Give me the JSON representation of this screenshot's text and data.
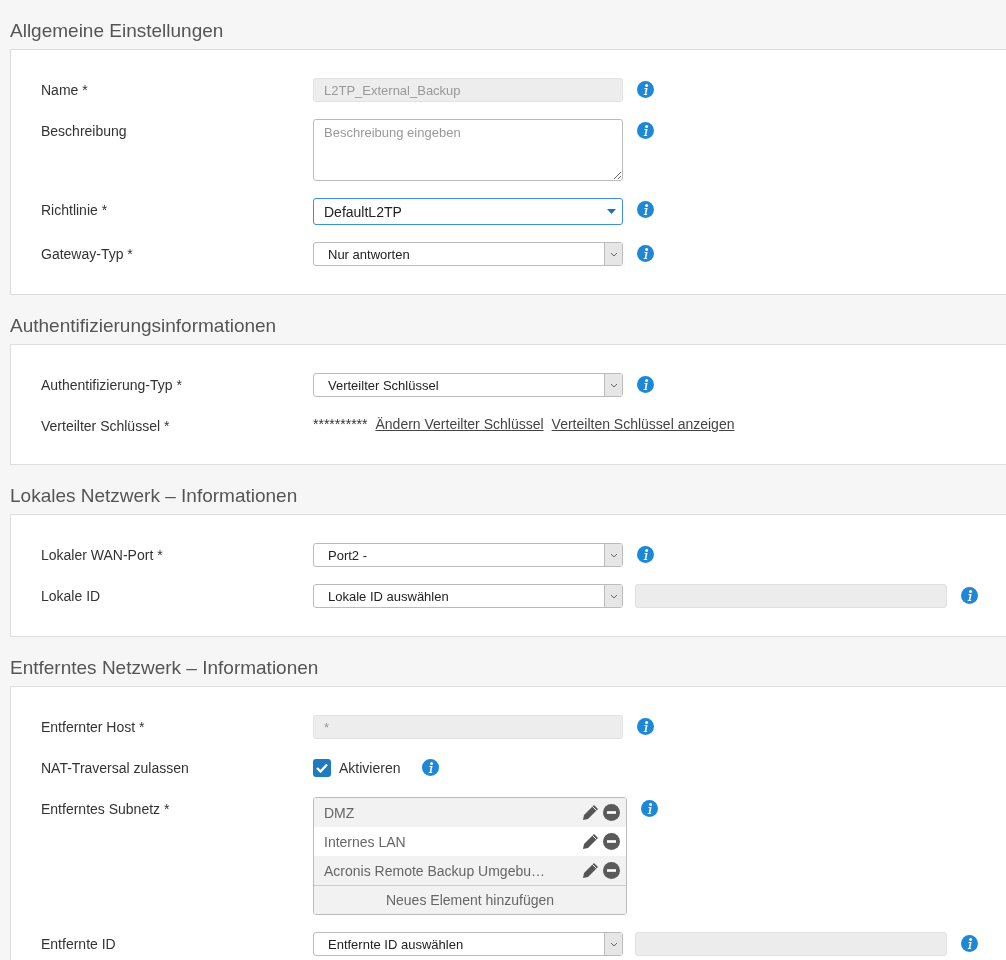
{
  "sections": [
    {
      "title": "Allgemeine Einstellungen",
      "rows": [
        {
          "label": "Name *",
          "kind": "text",
          "value": "L2TP_External_Backup",
          "disabled": true,
          "info": true
        },
        {
          "label": "Beschreibung",
          "kind": "textarea",
          "placeholder": "Beschreibung eingeben",
          "info": true
        },
        {
          "label": "Richtlinie *",
          "kind": "dropdown",
          "value": "DefaultL2TP",
          "focused": true,
          "info": true
        },
        {
          "label": "Gateway-Typ *",
          "kind": "dropdown",
          "value": "Nur antworten",
          "focused": false,
          "info": true
        }
      ]
    },
    {
      "title": "Authentifizierungsinformationen",
      "rows": [
        {
          "label": "Authentifizierung-Typ *",
          "kind": "dropdown",
          "value": "Verteilter Schlüssel",
          "focused": false,
          "info": true
        },
        {
          "label": "Verteilter Schlüssel *",
          "kind": "secret",
          "mask": "**********",
          "links": [
            "Ändern Verteilter Schlüssel",
            "Verteilten Schlüssel anzeigen"
          ],
          "info": false
        }
      ]
    },
    {
      "title": "Lokales Netzwerk – Informationen",
      "rows": [
        {
          "label": "Lokaler WAN-Port *",
          "kind": "dropdown",
          "value": "Port2 -",
          "focused": false,
          "info": true
        },
        {
          "label": "Lokale ID",
          "kind": "dropdown-field",
          "value": "Lokale ID auswählen",
          "focused": false,
          "info": true
        }
      ]
    },
    {
      "title": "Entferntes Netzwerk – Informationen",
      "rows": [
        {
          "label": "Entfernter Host *",
          "kind": "text",
          "value": "*",
          "disabled": true,
          "info": true
        },
        {
          "label": "NAT-Traversal zulassen",
          "kind": "checkbox",
          "text": "Aktivieren",
          "checked": true,
          "info": true
        },
        {
          "label": "Entferntes Subnetz *",
          "kind": "list",
          "items": [
            "DMZ",
            "Internes LAN",
            "Acronis Remote Backup Umgebu…"
          ],
          "add_label": "Neues Element hinzufügen",
          "info": true
        },
        {
          "label": "Entfernte ID",
          "kind": "dropdown-field",
          "value": "Entfernte ID auswählen",
          "focused": false,
          "info": true
        }
      ]
    }
  ]
}
